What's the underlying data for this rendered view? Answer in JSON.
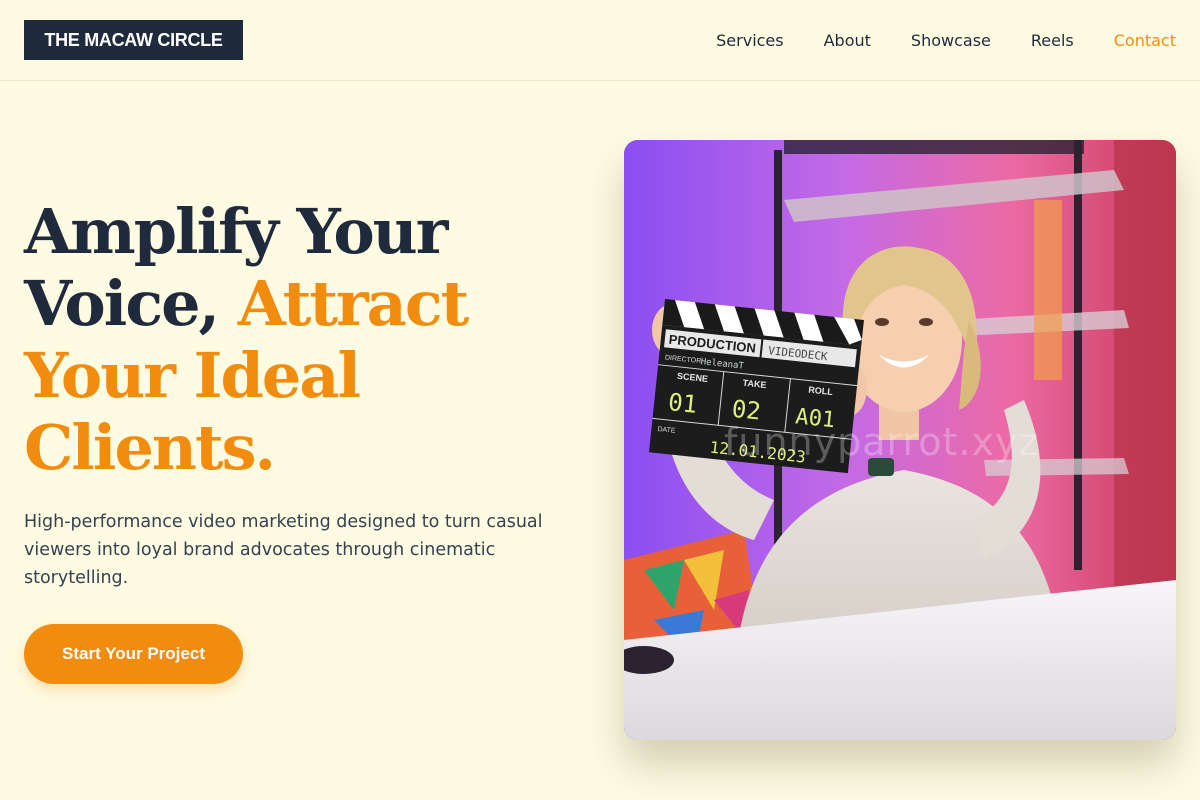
{
  "header": {
    "logo": "THE MACAW CIRCLE",
    "nav": [
      "Services",
      "About",
      "Showcase",
      "Reels",
      "Contact"
    ],
    "active_nav": "Contact"
  },
  "hero": {
    "headline": {
      "line1": "Amplify Your",
      "line2_dark": "Voice,",
      "line2_accent": "Attract",
      "line3_accent": "Your Ideal",
      "line4_accent": "Clients."
    },
    "subtext": "High-performance video marketing designed to turn casual viewers into loyal brand advocates through cinematic storytelling.",
    "cta_label": "Start Your Project",
    "image": {
      "clapper": {
        "title": "PRODUCTION",
        "brand": "VIDEODECK",
        "director_label": "DIRECTOR",
        "director": "HeleanaT",
        "scene_label": "SCENE",
        "scene": "01",
        "take_label": "TAKE",
        "take": "02",
        "roll_label": "ROLL",
        "roll": "A01",
        "date_label": "DATE",
        "date": "12.01.2023"
      },
      "watermark": "funnyparrot.xyz"
    }
  },
  "colors": {
    "background": "#fefbe3",
    "navy": "#1f2a3d",
    "accent": "#f28c0f"
  }
}
